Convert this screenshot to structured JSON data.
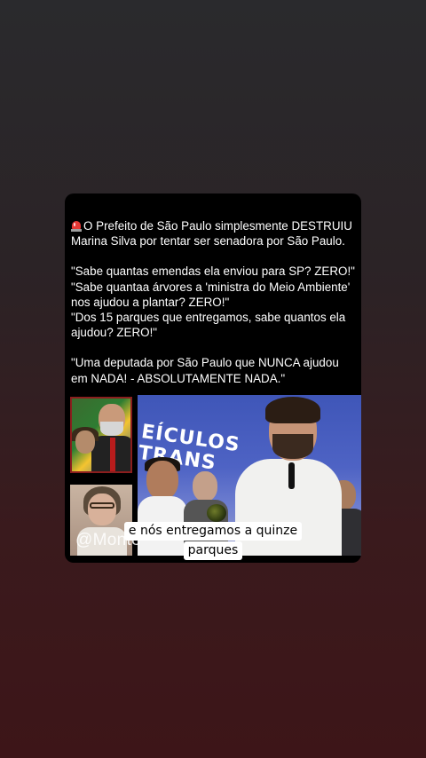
{
  "post": {
    "headline": "O Prefeito de São Paulo simplesmente DESTRUIU Marina Silva por tentar ser senadora por São Paulo.",
    "quote1": "\"Sabe quantas emendas ela enviou para SP? ZERO!\"",
    "quote2": "\"Sabe quantaa árvores a 'ministra do Meio Ambiente' nos ajudou a plantar? ZERO!\"",
    "quote3": "\"Dos 15 parques que entregamos, sabe quantos ela ajudou? ZERO!\"",
    "quote4": "\"Uma deputada por São Paulo que NUNCA ajudou em NADA! - ABSOLUTAMENTE NADA.\""
  },
  "video": {
    "banner_line1": "EÍCULOS",
    "banner_line2": "TRANS",
    "watermark": "@Monte"
  },
  "caption": {
    "line1": "e nós entregamos a quinze",
    "line2": "parques"
  },
  "icons": {
    "headline_icon": "police-light-icon",
    "creator": "creator-avatar-icon"
  }
}
